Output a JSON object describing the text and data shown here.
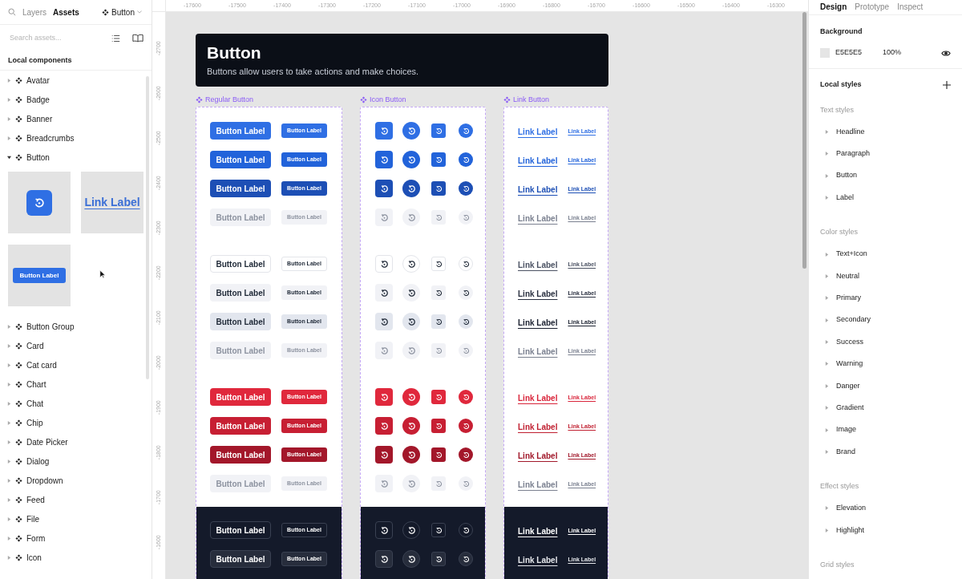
{
  "left_panel": {
    "tabs": [
      {
        "label": "Layers",
        "selected": false
      },
      {
        "label": "Assets",
        "selected": true
      }
    ],
    "page_selector": "Button",
    "search": {
      "placeholder": "Search assets..."
    },
    "section_title": "Local components",
    "components": [
      {
        "label": "Avatar",
        "expanded": false
      },
      {
        "label": "Badge",
        "expanded": false
      },
      {
        "label": "Banner",
        "expanded": false
      },
      {
        "label": "Breadcrumbs",
        "expanded": false
      },
      {
        "label": "Button",
        "expanded": true,
        "thumbnails": [
          {
            "kind": "icon"
          },
          {
            "kind": "link",
            "label": "Link Label"
          },
          {
            "kind": "button",
            "label": "Button Label"
          }
        ]
      },
      {
        "label": "Button Group",
        "expanded": false
      },
      {
        "label": "Card",
        "expanded": false
      },
      {
        "label": "Cat card",
        "expanded": false
      },
      {
        "label": "Chart",
        "expanded": false
      },
      {
        "label": "Chat",
        "expanded": false
      },
      {
        "label": "Chip",
        "expanded": false
      },
      {
        "label": "Date Picker",
        "expanded": false
      },
      {
        "label": "Dialog",
        "expanded": false
      },
      {
        "label": "Dropdown",
        "expanded": false
      },
      {
        "label": "Feed",
        "expanded": false
      },
      {
        "label": "File",
        "expanded": false
      },
      {
        "label": "Form",
        "expanded": false
      },
      {
        "label": "Icon",
        "expanded": false
      }
    ]
  },
  "rulers": {
    "horizontal": [
      "-17600",
      "-17500",
      "-17400",
      "-17300",
      "-17200",
      "-17100",
      "-17000",
      "-16900",
      "-16800",
      "-16700",
      "-16600",
      "-16500",
      "-16400",
      "-16300"
    ],
    "vertical": [
      "-2700",
      "-2600",
      "-2500",
      "-2400",
      "-2300",
      "-2200",
      "-2100",
      "-2000",
      "-1900",
      "-1800",
      "-1700",
      "-1600"
    ]
  },
  "canvas": {
    "header": {
      "title": "Button",
      "subtitle": "Buttons allow users to take actions and make choices."
    },
    "frames": [
      {
        "kind": "regular",
        "title": "Regular Button"
      },
      {
        "kind": "icon",
        "title": "Icon Button"
      },
      {
        "kind": "link",
        "title": "Link Button"
      }
    ],
    "groups": [
      {
        "dark": false,
        "rows": [
          {
            "kind": "solid",
            "color": "#2f6fe4",
            "buttons": [
              "Button Label",
              "Button Label"
            ],
            "link": {
              "color": "#2f6fe4",
              "labels": [
                "Link Label",
                "Link Label"
              ]
            }
          },
          {
            "kind": "solid",
            "color": "#2263da",
            "buttons": [
              "Button Label",
              "Button Label"
            ],
            "link": {
              "color": "#2263da",
              "labels": [
                "Link Label",
                "Link Label"
              ]
            }
          },
          {
            "kind": "solid",
            "color": "#1d4fb5",
            "buttons": [
              "Button Label",
              "Button Label"
            ],
            "link": {
              "color": "#1d4fb5",
              "labels": [
                "Link Label",
                "Link Label"
              ]
            }
          },
          {
            "kind": "disabled",
            "color": "#f1f2f6",
            "buttons": [
              "Button Label",
              "Button Label"
            ],
            "link": {
              "color": "#7b8190",
              "labels": [
                "Link Label",
                "Link Label"
              ]
            }
          }
        ]
      },
      {
        "dark": false,
        "rows": [
          {
            "kind": "outline",
            "color": "#ffffff",
            "buttons": [
              "Button Label",
              "Button Label"
            ],
            "link": {
              "color": "#4b5263",
              "labels": [
                "Link Label",
                "Link Label"
              ]
            }
          },
          {
            "kind": "light",
            "color": "#f1f2f6",
            "buttons": [
              "Button Label",
              "Button Label"
            ],
            "link": {
              "color": "#2a3040",
              "labels": [
                "Link Label",
                "Link Label"
              ]
            }
          },
          {
            "kind": "light",
            "color": "#e2e6ee",
            "buttons": [
              "Button Label",
              "Button Label"
            ],
            "link": {
              "color": "#1b2130",
              "labels": [
                "Link Label",
                "Link Label"
              ]
            }
          },
          {
            "kind": "disabled",
            "color": "#f1f2f6",
            "buttons": [
              "Button Label",
              "Button Label"
            ],
            "link": {
              "color": "#7b8190",
              "labels": [
                "Link Label",
                "Link Label"
              ]
            }
          }
        ]
      },
      {
        "dark": false,
        "rows": [
          {
            "kind": "solid",
            "color": "#e0283c",
            "buttons": [
              "Button Label",
              "Button Label"
            ],
            "link": {
              "color": "#d9243a",
              "labels": [
                "Link Label",
                "Link Label"
              ]
            }
          },
          {
            "kind": "solid",
            "color": "#c71f33",
            "buttons": [
              "Button Label",
              "Button Label"
            ],
            "link": {
              "color": "#c01f30",
              "labels": [
                "Link Label",
                "Link Label"
              ]
            }
          },
          {
            "kind": "solid",
            "color": "#a3172a",
            "buttons": [
              "Button Label",
              "Button Label"
            ],
            "link": {
              "color": "#a1182a",
              "labels": [
                "Link Label",
                "Link Label"
              ]
            }
          },
          {
            "kind": "disabled",
            "color": "#f1f2f6",
            "buttons": [
              "Button Label",
              "Button Label"
            ],
            "link": {
              "color": "#7b8190",
              "labels": [
                "Link Label",
                "Link Label"
              ]
            }
          }
        ]
      },
      {
        "dark": true,
        "rows": [
          {
            "kind": "dark",
            "color": "#141a2a",
            "buttons": [
              "Button Label",
              "Button Label"
            ],
            "link": {
              "color": "#ffffff",
              "labels": [
                "Link Label",
                "Link Label"
              ]
            }
          },
          {
            "kind": "dark",
            "color": "#272d3c",
            "buttons": [
              "Button Label",
              "Button Label"
            ],
            "link": {
              "color": "#e5e7eb",
              "labels": [
                "Link Label",
                "Link Label"
              ]
            }
          }
        ]
      }
    ]
  },
  "right_panel": {
    "tabs": [
      {
        "label": "Design",
        "selected": true
      },
      {
        "label": "Prototype",
        "selected": false
      },
      {
        "label": "Inspect",
        "selected": false
      }
    ],
    "background": {
      "title": "Background",
      "color": "#e5e5e5",
      "hex": "E5E5E5",
      "opacity": "100%"
    },
    "local_styles": {
      "title": "Local styles",
      "sections": [
        {
          "title": "Text styles",
          "items": [
            "Headline",
            "Paragraph",
            "Button",
            "Label"
          ]
        },
        {
          "title": "Color styles",
          "items": [
            "Text+Icon",
            "Neutral",
            "Primary",
            "Secondary",
            "Success",
            "Warning",
            "Danger",
            "Gradient",
            "Image",
            "Brand"
          ]
        },
        {
          "title": "Effect styles",
          "items": [
            "Elevation",
            "Highlight"
          ]
        },
        {
          "title": "Grid styles"
        }
      ]
    }
  }
}
